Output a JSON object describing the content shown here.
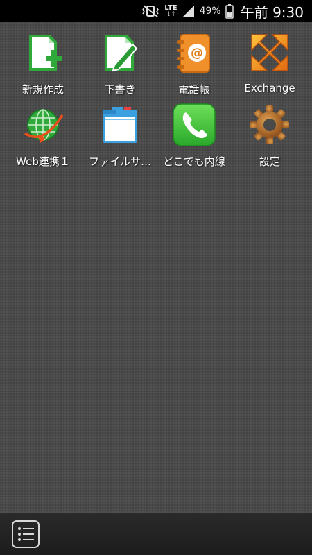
{
  "status_bar": {
    "network": "LTE",
    "battery_percent": "49%",
    "time": "午前 9:30",
    "icons": [
      "mute-vibrate-icon",
      "lte-icon",
      "signal-icon",
      "battery-charging-icon"
    ]
  },
  "apps": [
    {
      "id": "new",
      "label": "新規作成",
      "icon": "new-document-icon"
    },
    {
      "id": "draft",
      "label": "下書き",
      "icon": "draft-pen-icon"
    },
    {
      "id": "phonebook",
      "label": "電話帳",
      "icon": "address-book-icon"
    },
    {
      "id": "exchange",
      "label": "Exchange",
      "icon": "exchange-icon"
    },
    {
      "id": "web",
      "label": "Web連携１",
      "icon": "globe-icon"
    },
    {
      "id": "fileserver",
      "label": "ファイルサ…",
      "icon": "folder-icon"
    },
    {
      "id": "extension",
      "label": "どこでも内線",
      "icon": "phone-icon"
    },
    {
      "id": "settings",
      "label": "設定",
      "icon": "gear-icon"
    }
  ],
  "bottom_bar": {
    "icon": "menu-list-icon"
  },
  "colors": {
    "background": "#4a4a4a",
    "green": "#2faa3a",
    "orange": "#f0902a",
    "folder_blue": "#3aa0e0"
  }
}
